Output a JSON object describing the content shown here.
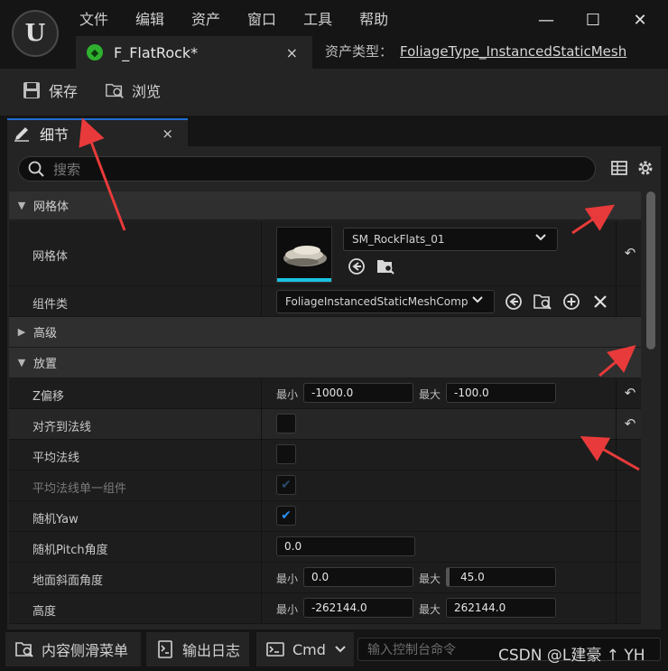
{
  "menu": [
    "文件",
    "编辑",
    "资产",
    "窗口",
    "工具",
    "帮助"
  ],
  "logo_letter": "U",
  "doc_tab": {
    "name": "F_FlatRock*",
    "close": "×"
  },
  "asset_type": {
    "label": "资产类型：",
    "value": "FoliageType_InstancedStaticMesh"
  },
  "window_controls": {
    "minimize": "—",
    "maximize": "☐",
    "close": "✕"
  },
  "toolbar": {
    "save_label": "保存",
    "browse_label": "浏览"
  },
  "details_tab": {
    "label": "细节",
    "close": "×"
  },
  "search": {
    "placeholder": "搜索"
  },
  "sections": {
    "mesh": {
      "title": "网格体"
    },
    "advanced": {
      "title": "高级"
    },
    "placement": {
      "title": "放置"
    }
  },
  "rows": {
    "mesh": {
      "label": "网格体",
      "value": "SM_RockFlats_01"
    },
    "component_class": {
      "label": "组件类",
      "value": "FoliageInstancedStaticMeshCompc"
    },
    "z_offset": {
      "label": "Z偏移",
      "min_label": "最小",
      "min": "-1000.0",
      "max_label": "最大",
      "max": "-100.0"
    },
    "align_to_normal": {
      "label": "对齐到法线",
      "checked": false
    },
    "average_normal": {
      "label": "平均法线",
      "checked": false
    },
    "average_normal_single": {
      "label": "平均法线单一组件",
      "checked": true,
      "disabled": true
    },
    "random_yaw": {
      "label": "随机Yaw",
      "checked": true
    },
    "random_pitch": {
      "label": "随机Pitch角度",
      "value": "0.0"
    },
    "ground_slope": {
      "label": "地面斜面角度",
      "min_label": "最小",
      "min": "0.0",
      "max_label": "最大",
      "max": "45.0"
    },
    "height": {
      "label": "高度",
      "min_label": "最小",
      "min": "-262144.0",
      "max_label": "最大",
      "max": "262144.0"
    }
  },
  "bottom": {
    "content_drawer": "内容侧滑菜单",
    "output_log": "输出日志",
    "cmd": "Cmd",
    "console_placeholder": "输入控制台命令"
  },
  "watermark": "CSDN @L建豪 ↑ YH",
  "colors": {
    "accent": "#1f6fd4",
    "checkbox": "#2b8ff6",
    "annotation_arrow": "#e83a3a",
    "thumb_bar": "#18c2e0"
  }
}
